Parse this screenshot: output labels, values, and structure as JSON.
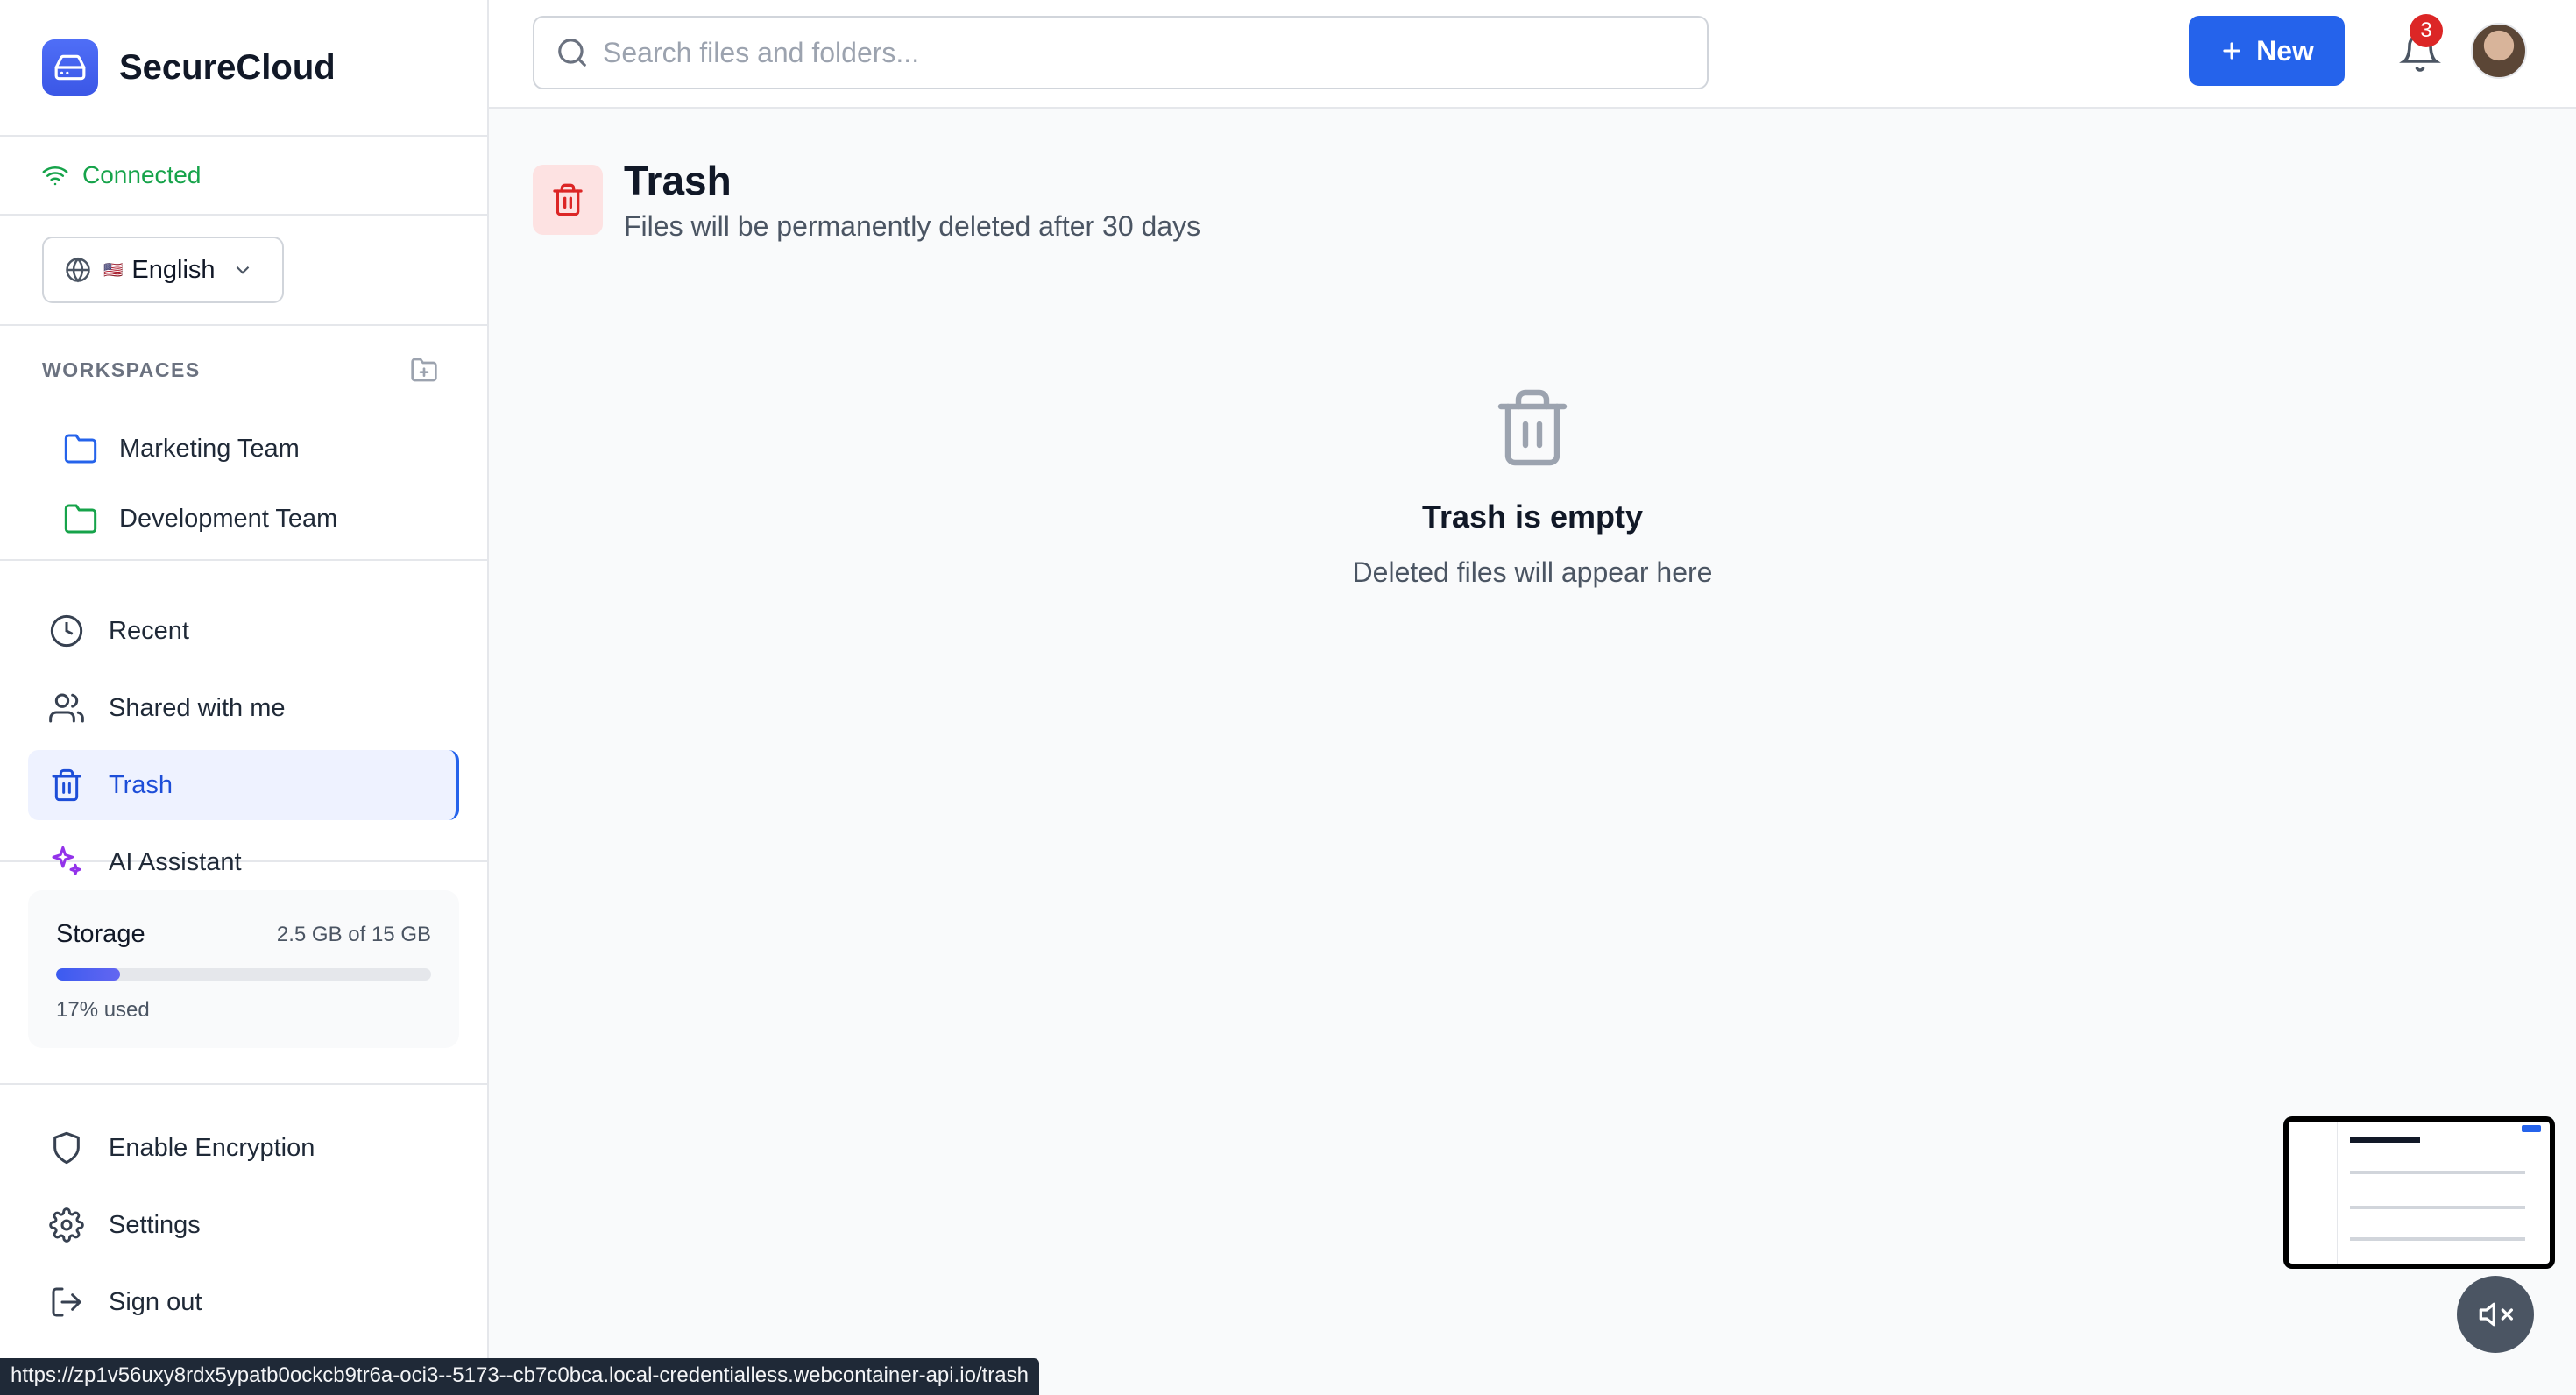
{
  "app": {
    "name": "SecureCloud"
  },
  "connection": {
    "status": "Connected"
  },
  "language": {
    "flag": "🇺🇸",
    "selected": "English"
  },
  "workspaces": {
    "heading": "WORKSPACES",
    "items": [
      {
        "label": "Marketing Team",
        "color": "#2563eb"
      },
      {
        "label": "Development Team",
        "color": "#16a34a"
      }
    ]
  },
  "nav": {
    "items": [
      {
        "label": "Recent",
        "icon": "clock-icon"
      },
      {
        "label": "Shared with me",
        "icon": "users-icon"
      },
      {
        "label": "Trash",
        "icon": "trash-icon",
        "active": true
      },
      {
        "label": "AI Assistant",
        "icon": "sparkles-icon"
      }
    ]
  },
  "storage": {
    "label": "Storage",
    "amount": "2.5 GB of 15 GB",
    "percent_text": "17% used",
    "percent": 17
  },
  "bottom_nav": {
    "items": [
      {
        "label": "Enable Encryption",
        "icon": "shield-icon"
      },
      {
        "label": "Settings",
        "icon": "gear-icon"
      },
      {
        "label": "Sign out",
        "icon": "logout-icon"
      }
    ]
  },
  "header": {
    "search_placeholder": "Search files and folders...",
    "new_button": "New",
    "notification_count": "3"
  },
  "page": {
    "title": "Trash",
    "subtitle": "Files will be permanently deleted after 30 days"
  },
  "empty_state": {
    "title": "Trash is empty",
    "subtitle": "Deleted files will appear here"
  },
  "status_bar": {
    "url": "https://zp1v56uxy8rdx5ypatb0ockcb9tr6a-oci3--5173--cb7c0bca.local-credentialless.webcontainer-api.io/trash"
  },
  "colors": {
    "accent": "#2563eb",
    "danger": "#dc2626",
    "success": "#16a34a",
    "ai": "#9333ea"
  }
}
